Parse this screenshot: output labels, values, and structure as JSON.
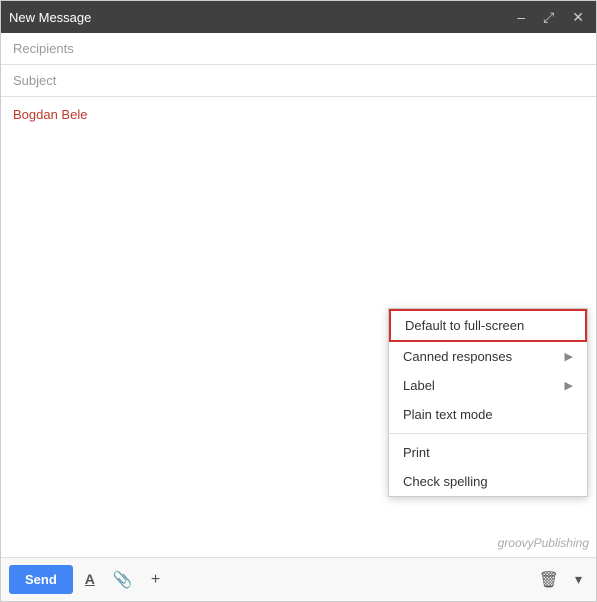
{
  "titlebar": {
    "title": "New Message",
    "minimize_label": "–",
    "expand_label": "⤢",
    "close_label": "✕"
  },
  "fields": {
    "recipients_placeholder": "Recipients",
    "subject_placeholder": "Subject"
  },
  "body": {
    "sender_name": "Bogdan Bele"
  },
  "context_menu": {
    "items": [
      {
        "label": "Default to full-screen",
        "highlighted": true,
        "has_arrow": false
      },
      {
        "label": "Canned responses",
        "highlighted": false,
        "has_arrow": true
      },
      {
        "label": "Label",
        "highlighted": false,
        "has_arrow": true
      },
      {
        "label": "Plain text mode",
        "highlighted": false,
        "has_arrow": false
      },
      {
        "divider": true
      },
      {
        "label": "Print",
        "highlighted": false,
        "has_arrow": false
      },
      {
        "label": "Check spelling",
        "highlighted": false,
        "has_arrow": false
      }
    ]
  },
  "toolbar": {
    "send_label": "Send"
  },
  "watermark": {
    "text": "groovyPublishing"
  }
}
